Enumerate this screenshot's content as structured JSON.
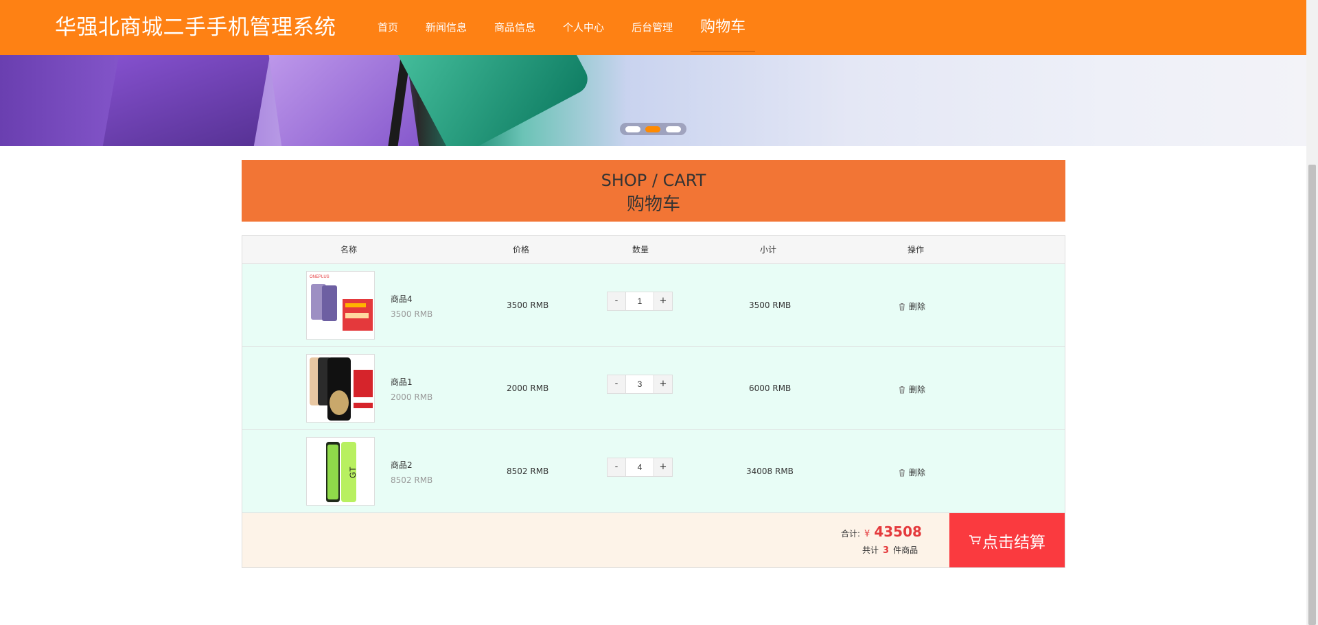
{
  "header": {
    "site_title": "华强北商城二手手机管理系统",
    "nav": [
      {
        "label": "首页"
      },
      {
        "label": "新闻信息"
      },
      {
        "label": "商品信息"
      },
      {
        "label": "个人中心"
      },
      {
        "label": "后台管理"
      },
      {
        "label": "购物车",
        "active": true
      }
    ],
    "accent_color": "#fe8114"
  },
  "carousel": {
    "slides": 3,
    "active_index": 1
  },
  "page_heading": {
    "en": "SHOP / CART",
    "cn": "购物车"
  },
  "cart": {
    "columns": [
      "名称",
      "价格",
      "数量",
      "小计",
      "操作"
    ],
    "items": [
      {
        "name": "商品4",
        "sub_price": "3500 RMB",
        "price": "3500 RMB",
        "quantity": "1",
        "subtotal": "3500 RMB",
        "delete_label": "删除",
        "minus": "-",
        "plus": "+",
        "image_icon": "oneplus-phone-image"
      },
      {
        "name": "商品1",
        "sub_price": "2000 RMB",
        "price": "2000 RMB",
        "quantity": "3",
        "subtotal": "6000 RMB",
        "delete_label": "删除",
        "minus": "-",
        "plus": "+",
        "image_icon": "iphone-xs-max-image"
      },
      {
        "name": "商品2",
        "sub_price": "8502 RMB",
        "price": "8502 RMB",
        "quantity": "4",
        "subtotal": "34008 RMB",
        "delete_label": "删除",
        "minus": "-",
        "plus": "+",
        "image_icon": "realme-gt-phone-image"
      }
    ],
    "summary": {
      "total_label": "合计:",
      "currency_symbol": "¥",
      "total_amount": "43508",
      "count_prefix": "共计",
      "count": "3",
      "count_suffix": "件商品",
      "checkout_label": "点击结算"
    },
    "checkout_color": "#fa3a3f"
  }
}
